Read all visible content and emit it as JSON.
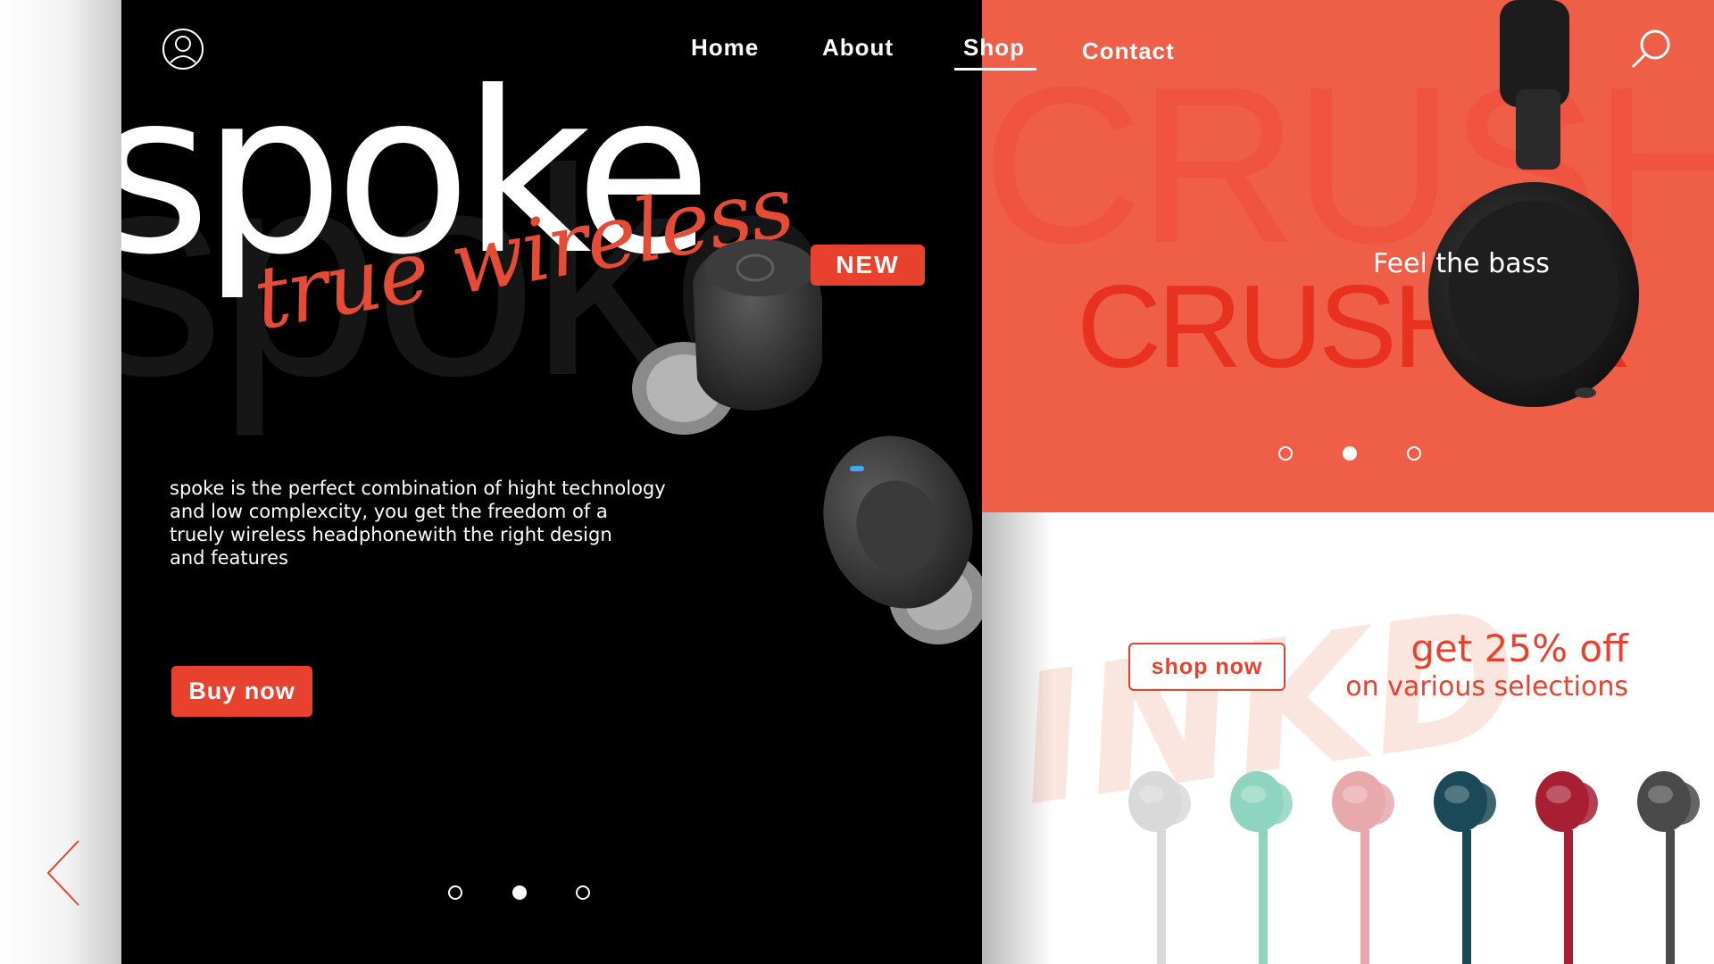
{
  "nav": {
    "links": [
      "Home",
      "About",
      "Shop",
      "Contact"
    ],
    "active": "Shop"
  },
  "hero": {
    "title": "spoke",
    "ghost_text": "spoke",
    "script_text": "true wireless",
    "badge": "NEW",
    "description_lines": [
      "spoke is the perfect combination of hight technology",
      "and low complexcity, you get the freedom of a",
      "truely wireless headphonewith the right design",
      "and features"
    ],
    "buy_label": "Buy now",
    "active_slide": 2
  },
  "promo": {
    "ghost_text": "CRUSHE",
    "tagline": "Feel the bass",
    "title": "CRUSHER",
    "active_slide": 2
  },
  "offer": {
    "shop_label": "shop now",
    "headline": "get 25% off",
    "subline": "on various selections",
    "ghost_text": "INKD",
    "product_colors": [
      "#d9d9d9",
      "#8fd4be",
      "#e8a9ad",
      "#1a4a57",
      "#a81f33",
      "#4a4a4a"
    ]
  },
  "colors": {
    "accent": "#e8412e",
    "promo_bg": "#ef5f48",
    "hero_bg": "#000000"
  }
}
